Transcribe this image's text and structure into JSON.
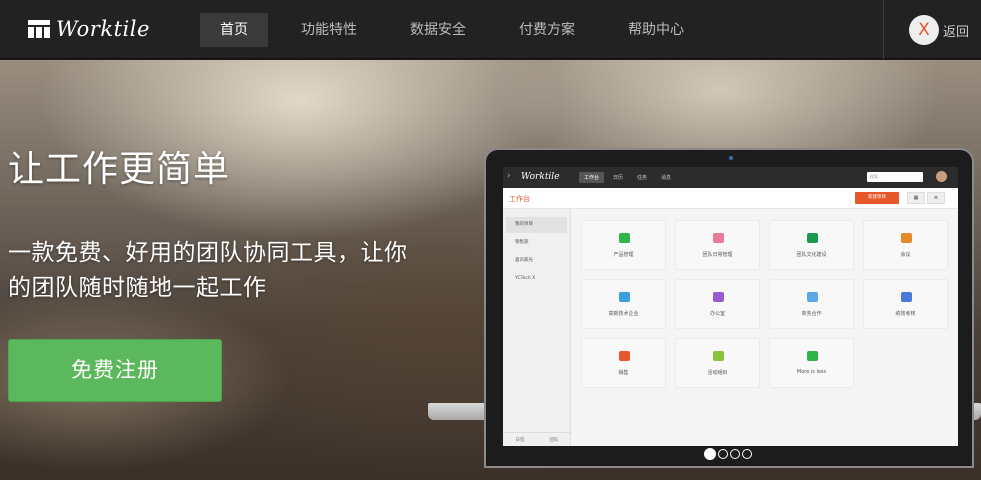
{
  "brand": {
    "name": "Worktile"
  },
  "nav": {
    "items": [
      {
        "label": "首页",
        "active": true
      },
      {
        "label": "功能特性",
        "active": false
      },
      {
        "label": "数据安全",
        "active": false
      },
      {
        "label": "付费方案",
        "active": false
      },
      {
        "label": "帮助中心",
        "active": false
      }
    ],
    "avatar_letter": "X",
    "back_label": "返回"
  },
  "hero": {
    "headline": "让工作更简单",
    "subline_1": "一款免费、好用的团队协同工具，让你",
    "subline_2": "的团队随时随地一起工作",
    "cta_label": "免费注册"
  },
  "screenshot": {
    "logo": "Worktile",
    "tabs": [
      {
        "label": "工作台",
        "active": true
      },
      {
        "label": "日历",
        "active": false
      },
      {
        "label": "任务",
        "active": false
      },
      {
        "label": "消息",
        "active": false
      }
    ],
    "search_placeholder": "搜索...",
    "page_title": "工作台",
    "new_project_label": "新建项目",
    "sidebar_items": [
      {
        "label": "我的项目",
        "active": true
      },
      {
        "label": "销售部",
        "active": false
      },
      {
        "label": "喜讯家光",
        "active": false
      },
      {
        "label": "YCTech X",
        "active": false
      }
    ],
    "sidebar_footer": [
      "日程",
      "团队"
    ],
    "projects": [
      {
        "label": "产品管理",
        "color": "#2fb44a"
      },
      {
        "label": "团队日常管理",
        "color": "#e87a9a"
      },
      {
        "label": "团队文化建设",
        "color": "#1a9a4a"
      },
      {
        "label": "会议",
        "color": "#e58a2a"
      },
      {
        "label": "高新技术企业",
        "color": "#3aa0e0"
      },
      {
        "label": "办公室",
        "color": "#9a5ad0"
      },
      {
        "label": "商务合作",
        "color": "#5aa8e8"
      },
      {
        "label": "绩效考核",
        "color": "#4a7ad8"
      },
      {
        "label": "销售",
        "color": "#e8572a"
      },
      {
        "label": "活动组织",
        "color": "#8ac43a"
      },
      {
        "label": "More is less",
        "color": "#2fb44a"
      }
    ]
  },
  "carousel": {
    "count": 4,
    "active_index": 0
  }
}
